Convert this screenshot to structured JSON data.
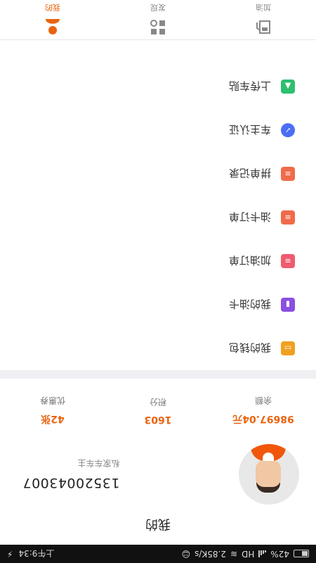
{
  "status_bar": {
    "time": "上午9:34",
    "speed": "2.85K/s",
    "network": "HD",
    "battery": "42%"
  },
  "header": {
    "title": "我的"
  },
  "profile": {
    "phone": "13520043007",
    "tag": "私家车车主"
  },
  "stats": [
    {
      "value": "98697.04元",
      "label": "余额"
    },
    {
      "value": "1603",
      "label": "积分"
    },
    {
      "value": "42张",
      "label": "优惠券"
    }
  ],
  "menu": [
    {
      "label": "我的钱包",
      "icon": "wallet-icon",
      "color": "#f0a020"
    },
    {
      "label": "我的油卡",
      "icon": "oil-card-icon",
      "color": "#8a4fe0"
    },
    {
      "label": "加油订单",
      "icon": "fuel-order-icon",
      "color": "#ef5b6f"
    },
    {
      "label": "油卡订单",
      "icon": "card-order-icon",
      "color": "#f06b4a"
    },
    {
      "label": "拼单记录",
      "icon": "group-order-icon",
      "color": "#f06b4a"
    },
    {
      "label": "车主认证",
      "icon": "verify-badge-icon",
      "color": "#4c6ef5"
    },
    {
      "label": "上传车贴",
      "icon": "image-upload-icon",
      "color": "#2fbf71"
    }
  ],
  "tabs": [
    {
      "label": "加油",
      "icon": "fuel-icon"
    },
    {
      "label": "发现",
      "icon": "discover-icon"
    },
    {
      "label": "我的",
      "icon": "profile-icon"
    }
  ],
  "colors": {
    "accent": "#e8640f"
  }
}
